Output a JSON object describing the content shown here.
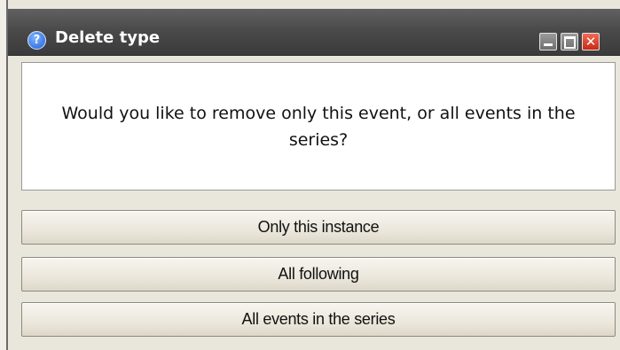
{
  "window": {
    "title": "Delete type",
    "title_icon": "help-icon",
    "controls": {
      "minimize_icon": "minimize-icon",
      "maximize_icon": "maximize-icon",
      "close_icon": "close-icon",
      "close_glyph": "✕"
    }
  },
  "dialog": {
    "message": "Would you like to remove only this event, or all events in the series?"
  },
  "buttons": {
    "only_this": "Only this instance",
    "all_following": "All following",
    "all_events": "All events in the series"
  },
  "colors": {
    "titlebar": "#4a4a4a",
    "close_button": "#d83a22",
    "dialog_background": "#e9e6dc"
  }
}
